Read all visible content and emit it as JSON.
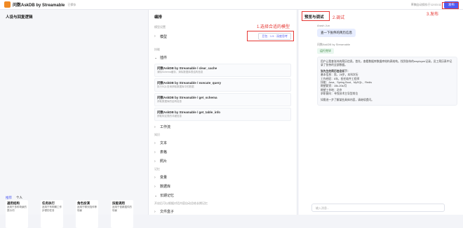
{
  "topbar": {
    "title": "问数AskDB by Streamable",
    "subtitle": "已保存",
    "save_info": "草稿自动保存于12:53:11",
    "publish": "发布"
  },
  "annotations": {
    "a1": "1.选择合适的模型",
    "a2": "2.调试",
    "a3": "3.发布"
  },
  "left": {
    "title": "人设与回复逻辑",
    "tabs": [
      "推荐",
      "个人"
    ]
  },
  "left_cards": [
    {
      "title": "通用结构",
      "desc": "适用于多种场景的提示词"
    },
    {
      "title": "任务执行",
      "desc": "适用于有明确工作步骤的任务"
    },
    {
      "title": "角色扮演",
      "desc": "适用于聊天陪伴等场景"
    },
    {
      "title": "技能调用",
      "desc": "适用于依赖插件的场景"
    }
  ],
  "mid": {
    "title": "编排",
    "model_section": "模型设置",
    "model_label": "模型",
    "model_value": "豆包 · 1.5 · 深度思考",
    "skills_section": "技能",
    "plugin_label": "插件",
    "plugins": [
      {
        "title": "问数AskDB by Streamable / clear_cache",
        "desc": "清除Schema缓存，清除数据库表结构信息"
      },
      {
        "title": "问数AskDB by Streamable / execute_query",
        "desc": "执行SQL查询获取数据库中的数据"
      },
      {
        "title": "问数AskDB by Streamable / get_schema",
        "desc": "获取数据库的结构信息"
      },
      {
        "title": "问数AskDB by Streamable / get_table_info",
        "desc": "获取特定表的详细信息"
      }
    ],
    "workflow": "工作流",
    "knowledge_section": "知识",
    "knowledge_rows": [
      "文本",
      "表格",
      "照片"
    ],
    "memory_section": "记忆",
    "memory_rows": [
      "变量",
      "数据库",
      "长期记忆"
    ],
    "memory_note": "开启后可以根据对话内容自动总结长期记忆",
    "file_box": "文件盒子"
  },
  "right": {
    "title": "预览与调试",
    "user": "Arash Jun",
    "user_msg": "查一下张伟的简历信息",
    "bot": "问数AskDB by Streamable",
    "running": "运行完毕",
    "answer": "用户让我查张伟的简历信息。首先，查看数据库数据库结构表结构。找到张伟的employee记录。员工简历表中记录了张伟的全部数据。",
    "resume_title": "张先生的简历信息如下：",
    "resume_lines": [
      "基本信息：男，28岁，本科学历",
      "工作经验：5年，担任软件工程师",
      "技能：Java、Spring Boot、MySQL、Redis",
      "期望薪资：15k-20k/月",
      "期望工作地：北京",
      "求职意向：寻找技术主导型岗位"
    ],
    "followup": "如需进一步了解某些具体内容，请继续提问。",
    "input_placeholder": "输入消息..."
  }
}
